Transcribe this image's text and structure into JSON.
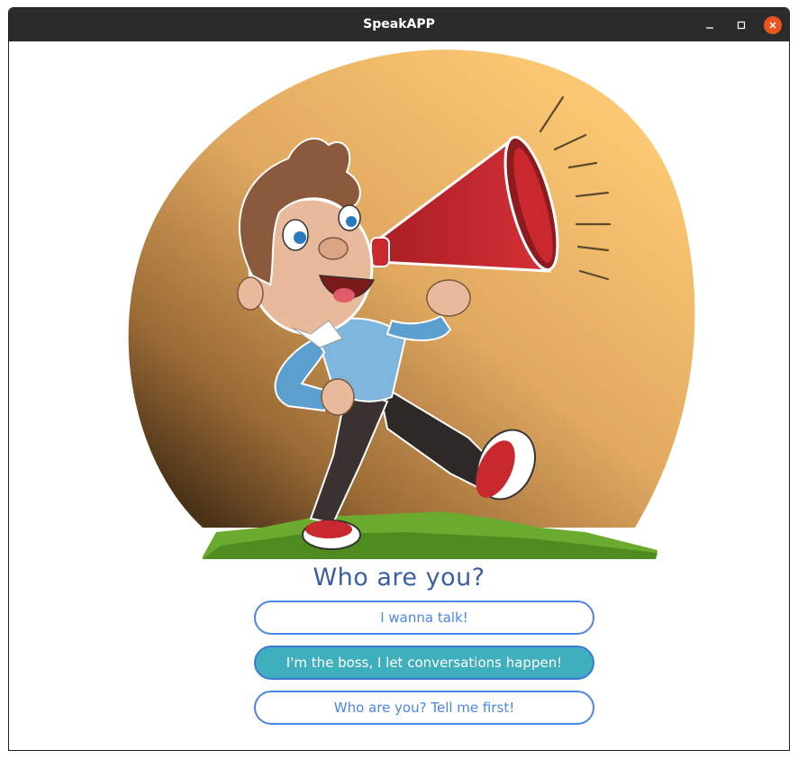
{
  "window": {
    "title": "SpeakAPP",
    "controls": [
      "minimize-icon",
      "maximize-icon",
      "close-icon"
    ],
    "close_color": "#e95420"
  },
  "main": {
    "illustration": "boy-with-megaphone-illustration",
    "heading": "Who are you?",
    "options": [
      {
        "label": "I wanna talk!",
        "selected": false
      },
      {
        "label": "I'm the boss, I let conversations happen!",
        "selected": true
      },
      {
        "label": "Who are you? Tell me first!",
        "selected": false
      }
    ]
  },
  "colors": {
    "heading": "#3b5ea6",
    "button_border": "#4a86e8",
    "button_text": "#4a86e8",
    "selected_fill": "#3faebd",
    "sun_light": "#fbc772",
    "sun_dark": "#5a4020",
    "grass": "#6aaa2e",
    "megaphone": "#c8282e"
  }
}
